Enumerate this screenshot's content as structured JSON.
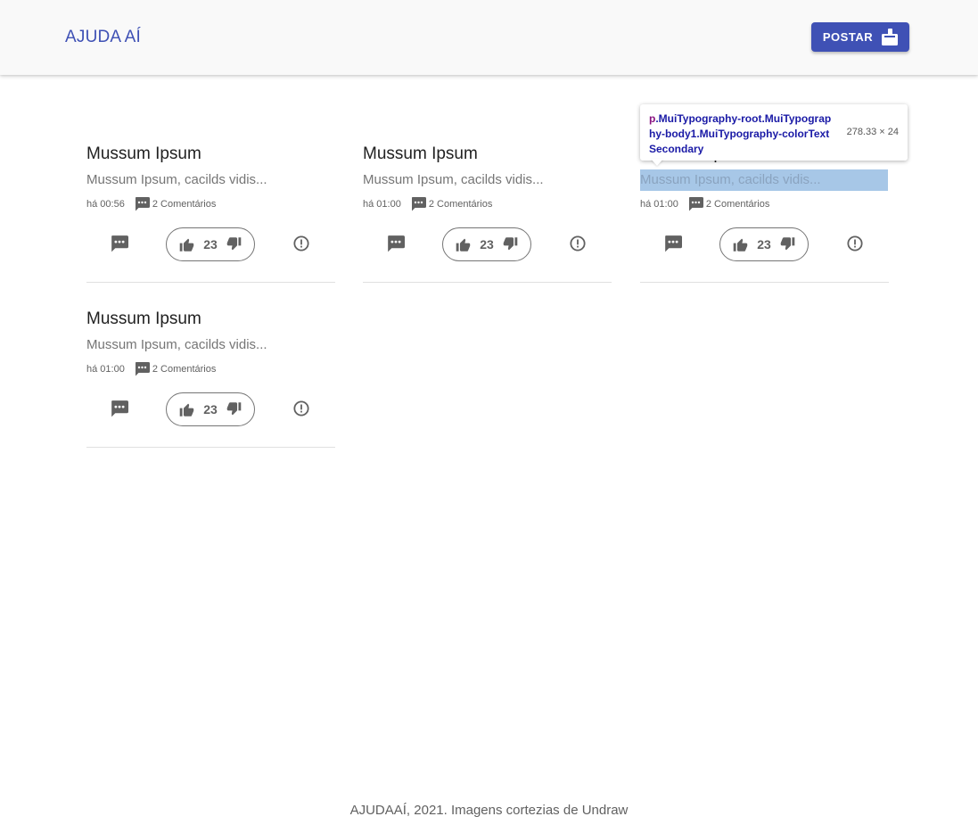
{
  "header": {
    "brand": "AJUDA AÍ",
    "post_button": "POSTAR",
    "post_icon": "post-add-icon"
  },
  "posts": [
    {
      "title": "Mussum Ipsum",
      "excerpt": "Mussum Ipsum, cacilds vidis...",
      "time": "há 00:56",
      "comments": "2 Comentários",
      "votes": "23"
    },
    {
      "title": "Mussum Ipsum",
      "excerpt": "Mussum Ipsum, cacilds vidis...",
      "time": "há 01:00",
      "comments": "2 Comentários",
      "votes": "23"
    },
    {
      "title": "Mussum Ipsum",
      "excerpt": "Mussum Ipsum, cacilds vidis...",
      "time": "há 01:00",
      "comments": "2 Comentários",
      "votes": "23"
    },
    {
      "title": "Mussum Ipsum",
      "excerpt": "Mussum Ipsum, cacilds vidis...",
      "time": "há 01:00",
      "comments": "2 Comentários",
      "votes": "23"
    }
  ],
  "inspector": {
    "selector_tag": "p",
    "selector_classes": ".MuiTypography-root.MuiTypography-body1.MuiTypography-colorTextSecondary",
    "dimensions": "278.33 × 24"
  },
  "footer": {
    "text": "AJUDAAÍ, 2021. Imagens cortezias de Undraw"
  },
  "colors": {
    "primary": "#3f51b5",
    "highlight": "#a7c7e7",
    "text_secondary": "#757575"
  }
}
